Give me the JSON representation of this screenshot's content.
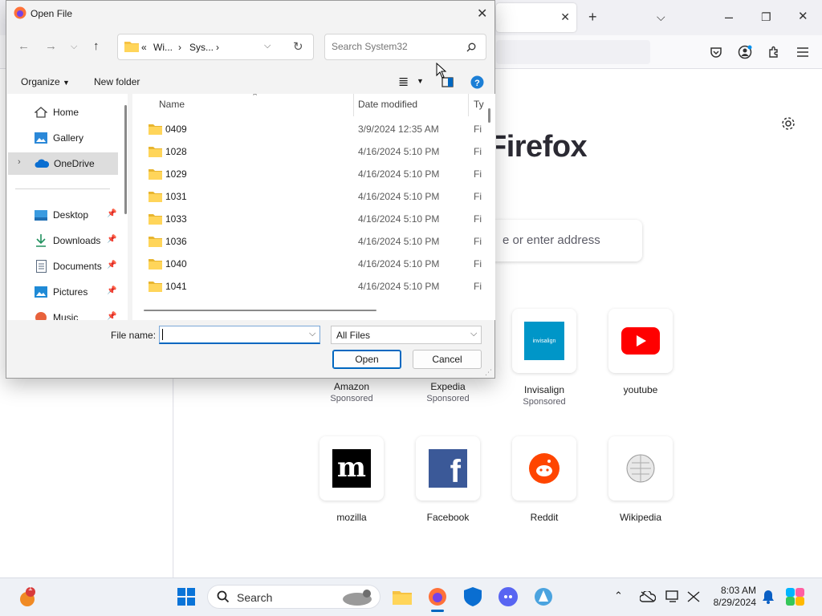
{
  "firefox": {
    "brand_title": "Firefox",
    "search_placeholder": "e or enter address",
    "shortcuts": [
      {
        "name": "Amazon",
        "sponsored": "Sponsored"
      },
      {
        "name": "Expedia",
        "sponsored": "Sponsored"
      },
      {
        "name": "Invisalign",
        "sponsored": "Sponsored",
        "logo_text": "invisalign"
      },
      {
        "name": "youtube"
      },
      {
        "name": "mozilla",
        "logo_text": "m"
      },
      {
        "name": "Facebook",
        "logo_text": "f"
      },
      {
        "name": "Reddit"
      },
      {
        "name": "Wikipedia"
      }
    ],
    "accent": "#0060df"
  },
  "dialog": {
    "title": "Open File",
    "breadcrumb": [
      "«",
      "Wi...",
      "›",
      "Sys...",
      "›"
    ],
    "search_placeholder": "Search System32",
    "toolbar": {
      "organize": "Organize",
      "new_folder": "New folder"
    },
    "nav": [
      {
        "label": "Home",
        "icon": "home-icon"
      },
      {
        "label": "Gallery",
        "icon": "gallery-icon"
      },
      {
        "label": "OneDrive",
        "icon": "onedrive-icon",
        "selected": true
      },
      {
        "label": "Desktop",
        "icon": "desktop-icon",
        "pinned": true
      },
      {
        "label": "Downloads",
        "icon": "download-icon",
        "pinned": true
      },
      {
        "label": "Documents",
        "icon": "documents-icon",
        "pinned": true
      },
      {
        "label": "Pictures",
        "icon": "pictures-icon",
        "pinned": true
      },
      {
        "label": "Music",
        "icon": "music-icon",
        "pinned": true
      }
    ],
    "columns": {
      "name": "Name",
      "date": "Date modified",
      "type": "Ty"
    },
    "files": [
      {
        "name": "0409",
        "date": "3/9/2024 12:35 AM",
        "type": "Fi"
      },
      {
        "name": "1028",
        "date": "4/16/2024 5:10 PM",
        "type": "Fi"
      },
      {
        "name": "1029",
        "date": "4/16/2024 5:10 PM",
        "type": "Fi"
      },
      {
        "name": "1031",
        "date": "4/16/2024 5:10 PM",
        "type": "Fi"
      },
      {
        "name": "1033",
        "date": "4/16/2024 5:10 PM",
        "type": "Fi"
      },
      {
        "name": "1036",
        "date": "4/16/2024 5:10 PM",
        "type": "Fi"
      },
      {
        "name": "1040",
        "date": "4/16/2024 5:10 PM",
        "type": "Fi"
      },
      {
        "name": "1041",
        "date": "4/16/2024 5:10 PM",
        "type": "Fi"
      }
    ],
    "file_name_label": "File name:",
    "file_name_value": "",
    "file_type": "All Files",
    "open_label": "Open",
    "cancel_label": "Cancel"
  },
  "taskbar": {
    "search_label": "Search",
    "time": "8:03 AM",
    "date": "8/29/2024",
    "notification_badge": "1"
  }
}
